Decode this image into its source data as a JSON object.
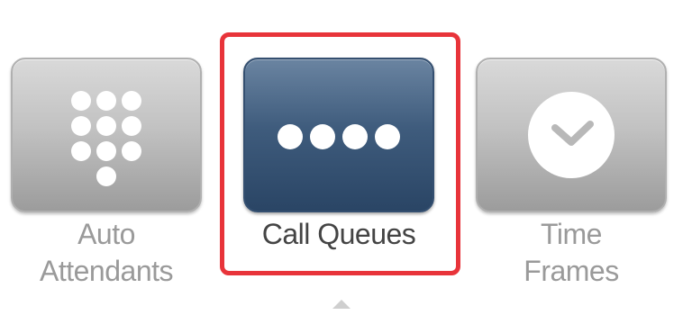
{
  "tabs": [
    {
      "id": "auto-attendants",
      "label_line1": "Auto",
      "label_line2": "Attendants",
      "icon": "keypad-icon",
      "selected": false
    },
    {
      "id": "call-queues",
      "label": "Call Queues",
      "icon": "ellipsis-dots-icon",
      "selected": true
    },
    {
      "id": "time-frames",
      "label_line1": "Time",
      "label_line2": "Frames",
      "icon": "clock-icon",
      "selected": false
    }
  ],
  "colors": {
    "selected_tile": "#3f5c7d",
    "unselected_tile": "#c2c2c2",
    "selection_outline": "#e8343a",
    "selected_label": "#444444",
    "unselected_label": "#9a9a9a"
  }
}
